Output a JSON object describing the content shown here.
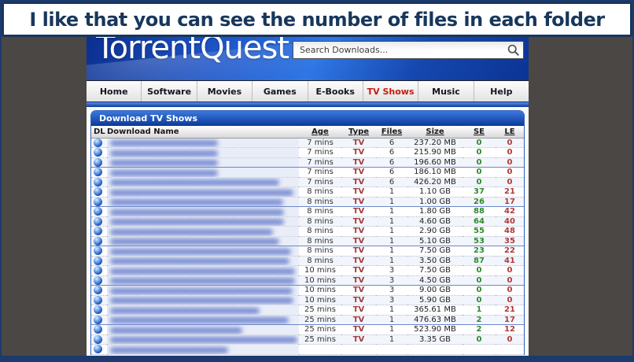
{
  "caption": {
    "text": "I like that you can see the number of files in each folder"
  },
  "site": {
    "logo": "TorrentQuest",
    "search": {
      "placeholder": "Search Downloads..."
    },
    "nav": {
      "items": [
        {
          "label": "Home",
          "active": false
        },
        {
          "label": "Software",
          "active": false
        },
        {
          "label": "Movies",
          "active": false
        },
        {
          "label": "Games",
          "active": false
        },
        {
          "label": "E-Books",
          "active": false
        },
        {
          "label": "TV Shows",
          "active": true
        },
        {
          "label": "Music",
          "active": false
        },
        {
          "label": "Help",
          "active": false
        }
      ]
    },
    "panel": {
      "title": "Download TV Shows"
    },
    "table": {
      "headers": {
        "dl": "DL",
        "name": "Download Name",
        "age": "Age",
        "type": "Type",
        "files": "Files",
        "size": "Size",
        "se": "SE",
        "le": "LE"
      },
      "rows": [
        {
          "age": "7 mins",
          "type": "TV",
          "files": "6",
          "size": "237.20 MB",
          "se": "0",
          "le": "0",
          "name_w": 137,
          "group_end": false
        },
        {
          "age": "7 mins",
          "type": "TV",
          "files": "6",
          "size": "215.90 MB",
          "se": "0",
          "le": "0",
          "name_w": 137,
          "group_end": false
        },
        {
          "age": "7 mins",
          "type": "TV",
          "files": "6",
          "size": "196.60 MB",
          "se": "0",
          "le": "0",
          "name_w": 137,
          "group_end": true
        },
        {
          "age": "7 mins",
          "type": "TV",
          "files": "6",
          "size": "186.10 MB",
          "se": "0",
          "le": "0",
          "name_w": 137,
          "group_end": false
        },
        {
          "age": "7 mins",
          "type": "TV",
          "files": "6",
          "size": "426.20 MB",
          "se": "0",
          "le": "0",
          "name_w": 215,
          "group_end": false
        },
        {
          "age": "8 mins",
          "type": "TV",
          "files": "1",
          "size": "1.10 GB",
          "se": "37",
          "le": "21",
          "name_w": 233,
          "group_end": false
        },
        {
          "age": "8 mins",
          "type": "TV",
          "files": "1",
          "size": "1.00 GB",
          "se": "26",
          "le": "17",
          "name_w": 220,
          "group_end": true
        },
        {
          "age": "8 mins",
          "type": "TV",
          "files": "1",
          "size": "1.80 GB",
          "se": "88",
          "le": "42",
          "name_w": 221,
          "group_end": false
        },
        {
          "age": "8 mins",
          "type": "TV",
          "files": "1",
          "size": "4.60 GB",
          "se": "64",
          "le": "40",
          "name_w": 221,
          "group_end": false
        },
        {
          "age": "8 mins",
          "type": "TV",
          "files": "1",
          "size": "2.90 GB",
          "se": "55",
          "le": "48",
          "name_w": 207,
          "group_end": false
        },
        {
          "age": "8 mins",
          "type": "TV",
          "files": "1",
          "size": "5.10 GB",
          "se": "53",
          "le": "35",
          "name_w": 215,
          "group_end": true
        },
        {
          "age": "8 mins",
          "type": "TV",
          "files": "1",
          "size": "7.50 GB",
          "se": "23",
          "le": "22",
          "name_w": 230,
          "group_end": false
        },
        {
          "age": "8 mins",
          "type": "TV",
          "files": "1",
          "size": "3.50 GB",
          "se": "87",
          "le": "41",
          "name_w": 228,
          "group_end": false
        },
        {
          "age": "10 mins",
          "type": "TV",
          "files": "3",
          "size": "7.50 GB",
          "se": "0",
          "le": "0",
          "name_w": 235,
          "group_end": false
        },
        {
          "age": "10 mins",
          "type": "TV",
          "files": "3",
          "size": "4.50 GB",
          "se": "0",
          "le": "0",
          "name_w": 235,
          "group_end": true
        },
        {
          "age": "10 mins",
          "type": "TV",
          "files": "3",
          "size": "9.00 GB",
          "se": "0",
          "le": "0",
          "name_w": 232,
          "group_end": false
        },
        {
          "age": "10 mins",
          "type": "TV",
          "files": "3",
          "size": "5.90 GB",
          "se": "0",
          "le": "0",
          "name_w": 233,
          "group_end": false
        },
        {
          "age": "25 mins",
          "type": "TV",
          "files": "1",
          "size": "365.61 MB",
          "se": "1",
          "le": "21",
          "name_w": 190,
          "group_end": false
        },
        {
          "age": "25 mins",
          "type": "TV",
          "files": "1",
          "size": "476.63 MB",
          "se": "2",
          "le": "17",
          "name_w": 227,
          "group_end": true
        },
        {
          "age": "25 mins",
          "type": "TV",
          "files": "1",
          "size": "523.90 MB",
          "se": "2",
          "le": "12",
          "name_w": 168,
          "group_end": false
        },
        {
          "age": "25 mins",
          "type": "TV",
          "files": "1",
          "size": "3.35 GB",
          "se": "0",
          "le": "0",
          "name_w": 238,
          "group_end": false
        },
        {
          "age": "",
          "type": "",
          "files": "",
          "size": "",
          "se": "",
          "le": "",
          "name_w": 150,
          "group_end": false
        }
      ]
    }
  },
  "colors": {
    "frame_navy": "#1c3a6e",
    "caption_navy": "#17375c",
    "surround_gray": "#4a4744",
    "header_blue": "#1e55c8",
    "panel_blue": "#0a3a99",
    "active_tab_red": "#c41e0e",
    "type_red": "#a33c3c",
    "seeders_green": "#2c8a2c",
    "leechers_red": "#b03a3a"
  }
}
